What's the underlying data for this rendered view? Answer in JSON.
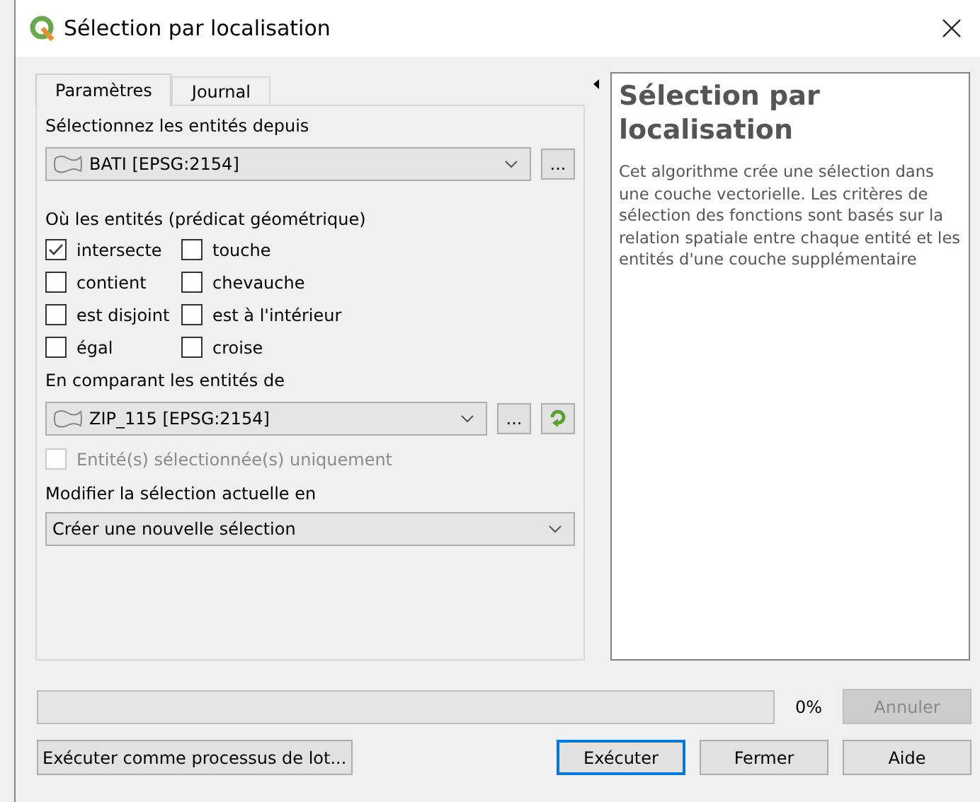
{
  "window": {
    "title": "Sélection par localisation"
  },
  "tabs": [
    {
      "label": "Paramètres",
      "selected": true
    },
    {
      "label": "Journal",
      "selected": false
    }
  ],
  "source": {
    "label": "Sélectionnez les entités depuis",
    "layer": "BATI [EPSG:2154]",
    "browse": "..."
  },
  "predicates": {
    "label": "Où les entités (prédicat géométrique)",
    "items": [
      {
        "label": "intersecte",
        "checked": true
      },
      {
        "label": "touche",
        "checked": false
      },
      {
        "label": "contient",
        "checked": false
      },
      {
        "label": "chevauche",
        "checked": false
      },
      {
        "label": "est disjoint",
        "checked": false
      },
      {
        "label": "est à l'intérieur",
        "checked": false
      },
      {
        "label": "égal",
        "checked": false
      },
      {
        "label": "croise",
        "checked": false
      }
    ]
  },
  "compare": {
    "label": "En comparant les entités de",
    "layer": "ZIP_115 [EPSG:2154]",
    "browse": "...",
    "selected_only": {
      "label": "Entité(s) sélectionnée(s) uniquement",
      "checked": false,
      "disabled": true
    }
  },
  "method": {
    "label": "Modifier la sélection actuelle en",
    "value": "Créer une nouvelle sélection"
  },
  "help": {
    "title": "Sélection par localisation",
    "text": "Cet algorithme crée une sélection dans une couche vectorielle. Les critères de sélection des fonctions sont basés sur la relation spatiale entre chaque entité et les entités d'une couche supplémentaire"
  },
  "progress": {
    "level": 0,
    "reading": "0%"
  },
  "cancel_button": {
    "label": "Annuler",
    "disabled": true
  },
  "buttons": [
    {
      "label": "Exécuter comme processus de lot...",
      "default": false
    },
    {
      "label": "Exécuter",
      "default": true
    },
    {
      "label": "Fermer",
      "default": false
    },
    {
      "label": "Aide",
      "default": false
    }
  ]
}
